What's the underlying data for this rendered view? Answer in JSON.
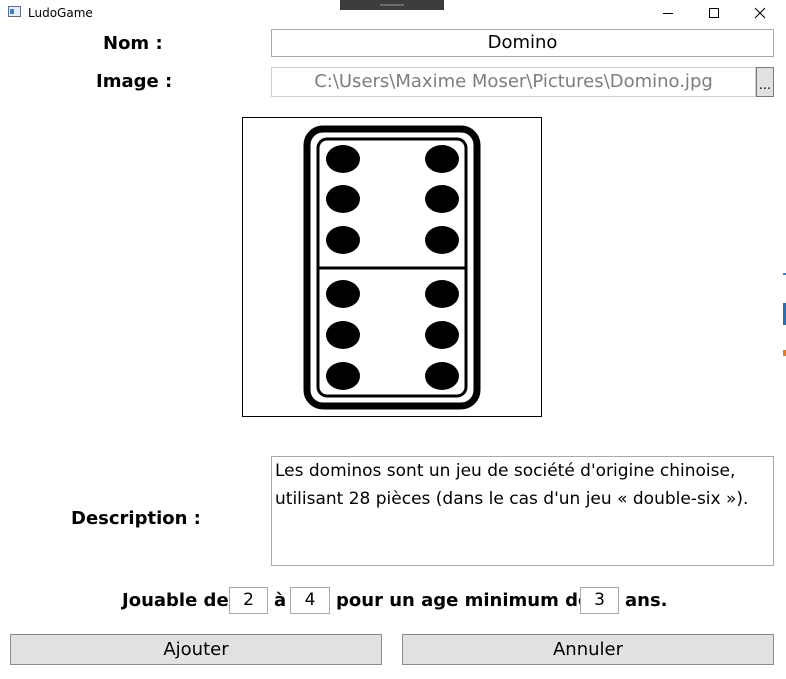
{
  "window": {
    "title": "LudoGame"
  },
  "form": {
    "name_label": "Nom :",
    "name_value": "Domino",
    "image_label": "Image :",
    "image_path": "C:\\Users\\Maxime Moser\\Pictures\\Domino.jpg",
    "browse_label": "...",
    "description_label": "Description :",
    "description_value": "Les dominos sont un jeu de société d'origine chinoise, utilisant 28 pièces (dans le cas d'un jeu « double-six »).",
    "players_prefix": "Jouable de",
    "players_min": "2",
    "players_sep": "à",
    "players_max": "4",
    "age_text": "pour un age minimum de",
    "age_min": "3",
    "age_suffix": "ans."
  },
  "buttons": {
    "add": "Ajouter",
    "cancel": "Annuler"
  },
  "icons": {
    "app": "app-window-icon",
    "minimize": "minimize-icon",
    "maximize": "maximize-icon",
    "close": "close-icon",
    "domino": "domino-image"
  }
}
